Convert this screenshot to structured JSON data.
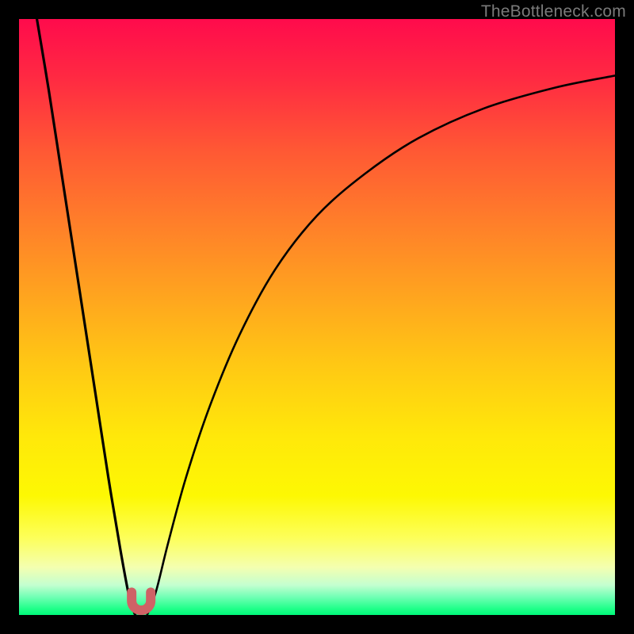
{
  "watermark": "TheBottleneck.com",
  "colors": {
    "frame": "#000000",
    "curve": "#000000",
    "marker": "#cf6266",
    "gradient_top": "#ff0b4c",
    "gradient_bottom": "#00f87a"
  },
  "chart_data": {
    "type": "line",
    "title": "",
    "xlabel": "",
    "ylabel": "",
    "xlim": [
      0,
      100
    ],
    "ylim": [
      0,
      100
    ],
    "grid": false,
    "legend": false,
    "annotations": [
      {
        "text": "TheBottleneck.com",
        "position": "top-right"
      }
    ],
    "series": [
      {
        "name": "left-branch",
        "description": "steep descending curve from top-left into the trough",
        "x": [
          3,
          5,
          7,
          9,
          11,
          13,
          15,
          17,
          18.5,
          19.5
        ],
        "y": [
          100,
          88,
          75,
          62,
          49,
          36,
          23,
          11,
          3,
          0
        ]
      },
      {
        "name": "right-branch",
        "description": "rising curve from trough approaching an asymptote below the top edge",
        "x": [
          21.5,
          23,
          25,
          28,
          32,
          37,
          43,
          50,
          58,
          67,
          78,
          90,
          100
        ],
        "y": [
          0,
          4,
          12,
          23,
          35,
          47,
          58,
          67,
          74,
          80,
          85,
          88.5,
          90.5
        ]
      }
    ],
    "marker": {
      "name": "trough-u-marker",
      "shape": "u",
      "color": "#cf6266",
      "x_center": 20.5,
      "y_base": 0,
      "width_x": 3.2,
      "height_y": 3.8
    }
  }
}
